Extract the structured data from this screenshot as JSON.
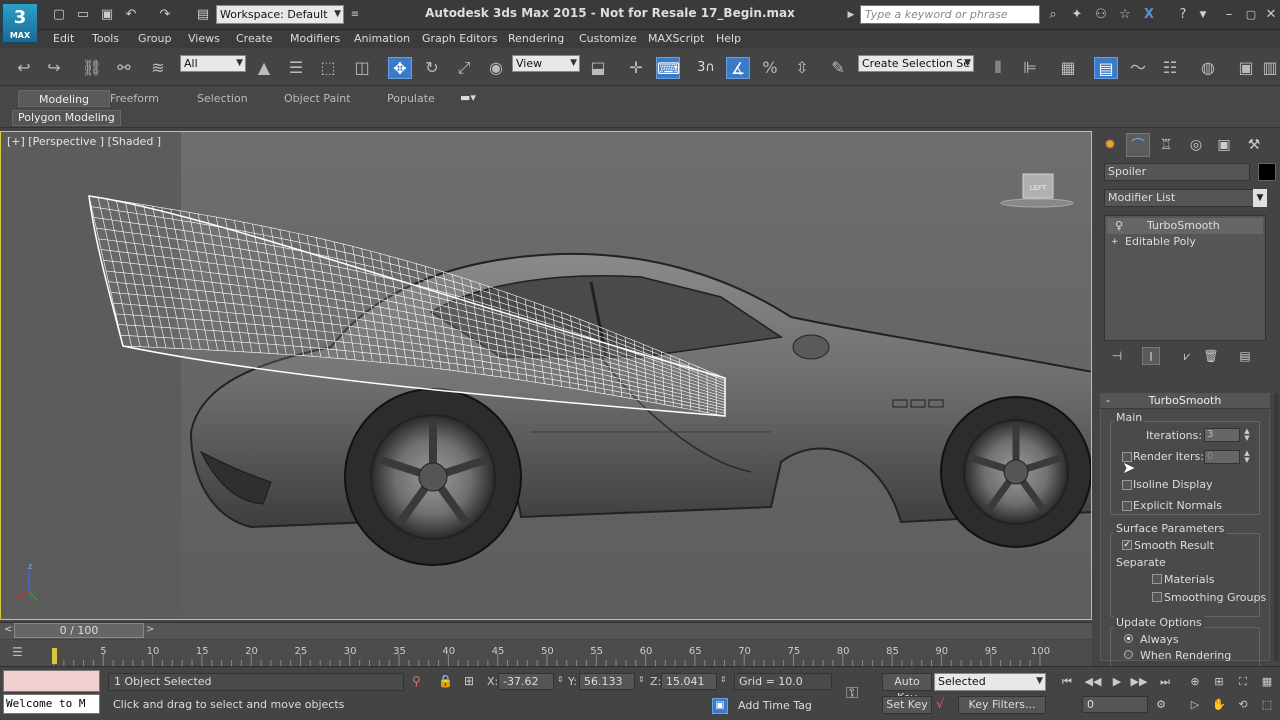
{
  "app": {
    "logo": "3",
    "logo_sub": "MAX",
    "title": "Autodesk 3ds Max  2015   - Not for Resale    17_Begin.max",
    "workspace": "Workspace: Default",
    "search_placeholder": "Type a keyword or phrase"
  },
  "menus": [
    "Edit",
    "Tools",
    "Group",
    "Views",
    "Create",
    "Modifiers",
    "Animation",
    "Graph Editors",
    "Rendering",
    "Customize",
    "MAXScript",
    "Help"
  ],
  "toolbar": {
    "selection_filter": "All",
    "ref_coord": "View",
    "snap_label": "3",
    "named_selection": "Create Selection Se"
  },
  "ribbon": {
    "tabs": [
      "Modeling",
      "Freeform",
      "Selection",
      "Object Paint",
      "Populate"
    ],
    "active_tab": "Modeling",
    "panel": "Polygon Modeling"
  },
  "viewport": {
    "label": "[+] [Perspective ] [Shaded ]",
    "viewcube_label": "LEFT",
    "axis_z": "z"
  },
  "command_panel": {
    "object_name": "Spoiler",
    "object_color": "#000000",
    "modifier_list": "Modifier List",
    "stack": [
      "TurboSmooth",
      "Editable Poly"
    ],
    "rollout_title": "TurboSmooth",
    "main_group": "Main",
    "iterations_label": "Iterations:",
    "iterations_value": "3",
    "render_iters_label": "Render Iters:",
    "render_iters_value": "0",
    "isoline_label": "Isoline Display",
    "explicit_normals_label": "Explicit Normals",
    "surface_group": "Surface Parameters",
    "smooth_result_label": "Smooth Result",
    "separate_label": "Separate",
    "materials_label": "Materials",
    "smoothing_groups_label": "Smoothing Groups",
    "update_group": "Update Options",
    "always_label": "Always",
    "when_rendering_label": "When Rendering"
  },
  "timeline": {
    "frame_display": "0 / 100",
    "ticks": [
      "0",
      "5",
      "10",
      "15",
      "20",
      "25",
      "30",
      "35",
      "40",
      "45",
      "50",
      "55",
      "60",
      "65",
      "70",
      "75",
      "80",
      "85",
      "90",
      "95",
      "100"
    ]
  },
  "status": {
    "listener": "Welcome to M",
    "selection": "1 Object Selected",
    "prompt": "Click and drag to select and move objects",
    "x_label": "X:",
    "x_value": "-37.62",
    "y_label": "Y:",
    "y_value": "56.133",
    "z_label": "Z:",
    "z_value": "15.041",
    "grid": "Grid = 10.0",
    "add_time_tag": "Add Time Tag",
    "auto_key": "Auto Key",
    "key_mode": "Selected",
    "set_key": "Set Key",
    "key_filters": "Key Filters...",
    "current_frame": "0"
  }
}
